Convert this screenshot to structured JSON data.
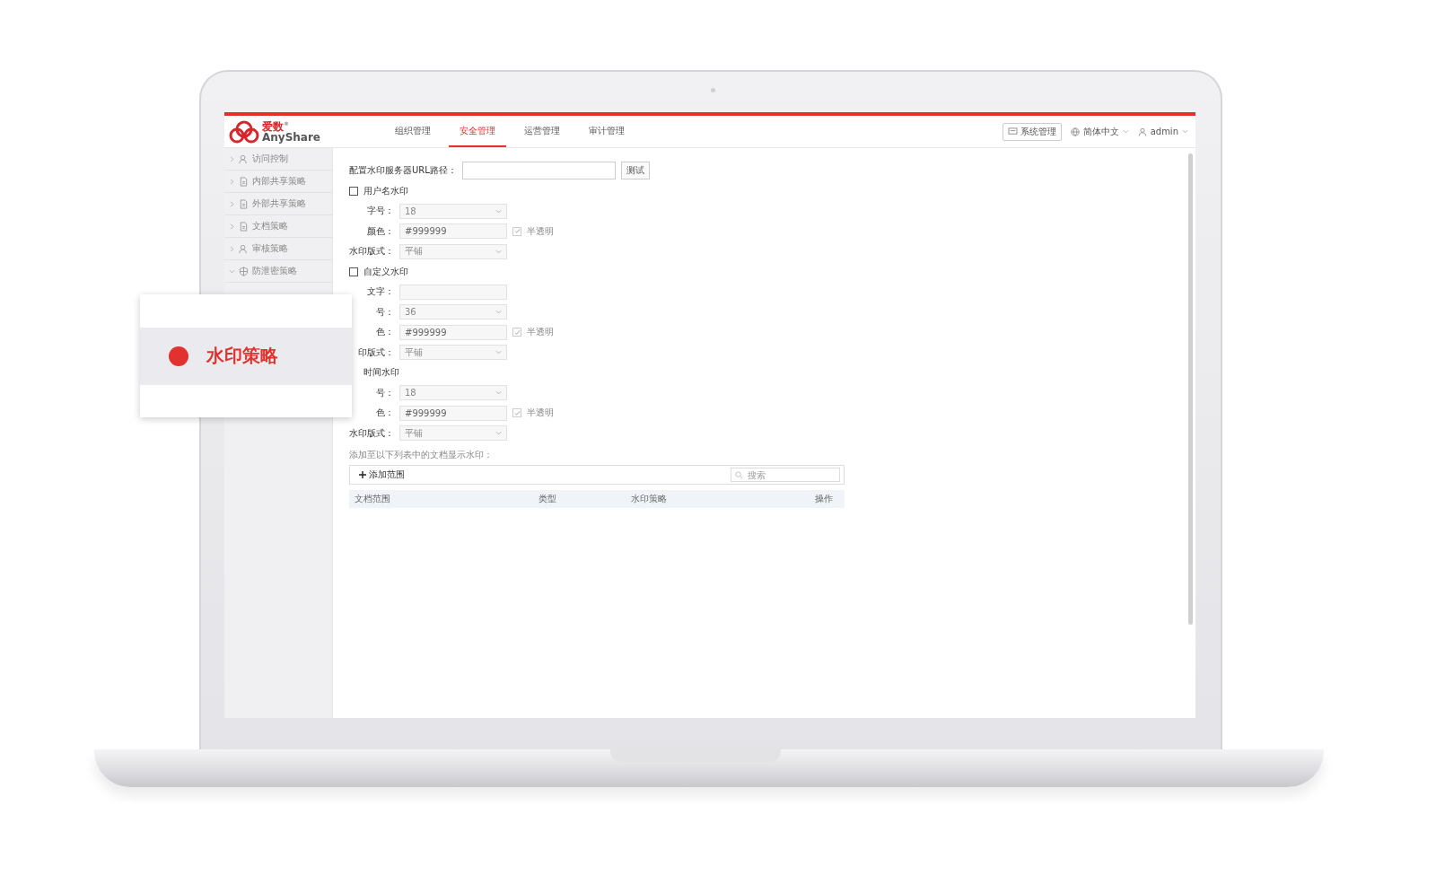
{
  "brand": {
    "name_cn": "爱数",
    "name_en": "AnyShare",
    "mark": "®"
  },
  "nav_tabs": [
    {
      "label": "组织管理",
      "selected": false
    },
    {
      "label": "安全管理",
      "selected": true
    },
    {
      "label": "运营管理",
      "selected": false
    },
    {
      "label": "审计管理",
      "selected": false
    }
  ],
  "header_actions": {
    "system_button": "系统管理",
    "language": "简体中文",
    "user": "admin"
  },
  "sidebar": {
    "items": [
      {
        "label": "访问控制",
        "expanded": false
      },
      {
        "label": "内部共享策略",
        "expanded": false
      },
      {
        "label": "外部共享策略",
        "expanded": false
      },
      {
        "label": "文档策略",
        "expanded": false
      },
      {
        "label": "审核策略",
        "expanded": false
      },
      {
        "label": "防泄密策略",
        "expanded": true
      }
    ]
  },
  "form": {
    "url_label": "配置水印服务器URL路径：",
    "test_button": "测试",
    "sections": [
      {
        "label": "用户名水印",
        "checked": false,
        "fields": [
          {
            "kind": "select",
            "label": "字号：",
            "value": "18"
          },
          {
            "kind": "color",
            "label": "颜色：",
            "value": "#999999",
            "option": "半透明",
            "option_checked": true
          },
          {
            "kind": "select",
            "label": "水印版式：",
            "value": "平铺"
          }
        ]
      },
      {
        "label": "自定义水印",
        "checked": false,
        "fields": [
          {
            "kind": "text",
            "label": "文字："
          },
          {
            "kind": "select",
            "label": "号：",
            "value": "36"
          },
          {
            "kind": "color",
            "label": "色：",
            "value": "#999999",
            "option": "半透明",
            "option_checked": true
          },
          {
            "kind": "select",
            "label": "印版式：",
            "value": "平铺"
          }
        ]
      },
      {
        "label": "时间水印",
        "fields": [
          {
            "kind": "select",
            "label": "号：",
            "value": "18"
          },
          {
            "kind": "color",
            "label": "色：",
            "value": "#999999",
            "option": "半透明",
            "option_checked": true
          },
          {
            "kind": "select",
            "label": "水印版式：",
            "value": "平铺"
          }
        ]
      }
    ]
  },
  "scope": {
    "hint": "添加至以下列表中的文档显示水印：",
    "add_button": "添加范围",
    "search": {
      "placeholder": "搜索"
    },
    "columns": [
      "文档范围",
      "类型",
      "水印策略",
      "操作"
    ]
  },
  "callout": {
    "label": "水印策略"
  }
}
